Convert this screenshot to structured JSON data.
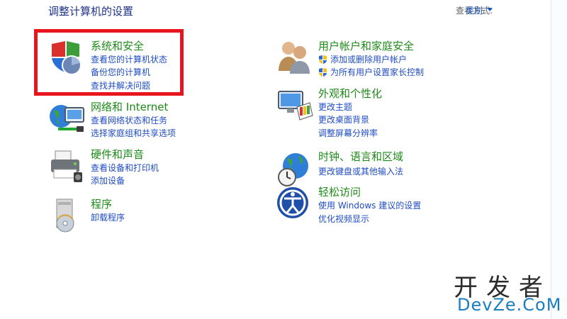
{
  "header": {
    "title": "调整计算机的设置",
    "view_by_label": "查看方式:",
    "view_by_value": "类别"
  },
  "categories": [
    {
      "title": "系统和安全",
      "links": [
        "查看您的计算机状态",
        "备份您的计算机",
        "查找并解决问题"
      ]
    },
    {
      "title": "网络和 Internet",
      "links": [
        "查看网络状态和任务",
        "选择家庭组和共享选项"
      ]
    },
    {
      "title": "硬件和声音",
      "links": [
        "查看设备和打印机",
        "添加设备"
      ]
    },
    {
      "title": "程序",
      "links": [
        "卸载程序"
      ]
    },
    {
      "title": "用户帐户和家庭安全",
      "links": [
        "添加或删除用户帐户",
        "为所有用户设置家长控制"
      ]
    },
    {
      "title": "外观和个性化",
      "links": [
        "更改主题",
        "更改桌面背景",
        "调整屏幕分辨率"
      ]
    },
    {
      "title": "时钟、语言和区域",
      "links": [
        "更改键盘或其他输入法"
      ]
    },
    {
      "title": "轻松访问",
      "links": [
        "使用 Windows 建议的设置",
        "优化视频显示"
      ]
    }
  ],
  "watermark": {
    "cn": "开发者",
    "en": "DevZe.CoM"
  },
  "colors": {
    "title_green": "#1d8a17",
    "link_blue": "#1f4cc4",
    "highlight_red": "#e8141e"
  }
}
